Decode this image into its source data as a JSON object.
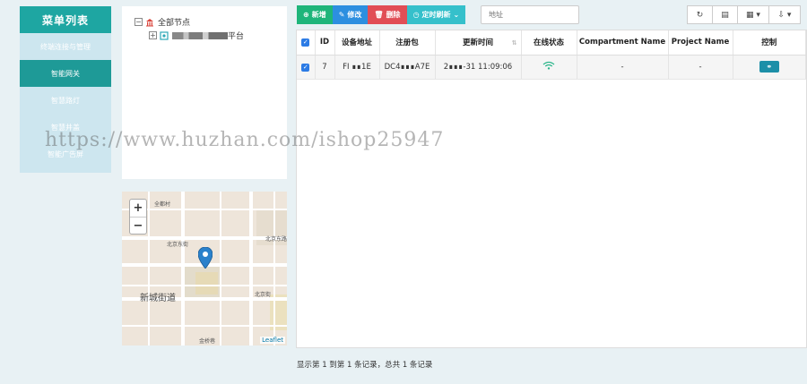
{
  "menu": {
    "title": "菜单列表",
    "items": [
      {
        "label": "终端连接与管理"
      },
      {
        "label": "智能网关"
      },
      {
        "label": "智慧路灯"
      },
      {
        "label": "智慧井盖"
      },
      {
        "label": "智能广告屏"
      }
    ]
  },
  "tree": {
    "root_label": "全部节点",
    "child_suffix": "平台"
  },
  "map": {
    "zoom_in": "+",
    "zoom_out": "−",
    "attribution": "Leaflet",
    "district": "新城街道",
    "streets": [
      "北京东街",
      "北京东路",
      "北京街",
      "新城街道",
      "金桥巷",
      "全都村"
    ]
  },
  "toolbar": {
    "add": "新增",
    "edit": "修改",
    "delete": "删除",
    "timer": "定时刷新",
    "search_placeholder": "地址"
  },
  "table": {
    "headers": [
      "ID",
      "设备地址",
      "注册包",
      "更新时间",
      "在线状态",
      "Compartment Name",
      "Project Name",
      "控制"
    ],
    "rows": [
      {
        "id": "7",
        "address": "FI  ∎∎1E",
        "register": "DC4∎∎∎A7E",
        "updated": "2∎∎∎-31 11:09:06",
        "compartment": "-",
        "project": "-"
      }
    ]
  },
  "footer": "显示第 1 到第 1 条记录，总共 1 条记录",
  "watermark": "https://www.huzhan.com/ishop25947",
  "colors": {
    "menu_title": "#1ea6a2",
    "menu_active": "#1e9a97",
    "add": "#1eb57a",
    "edit": "#2c8fe0",
    "delete": "#e14e56",
    "timer": "#35c0cb"
  }
}
